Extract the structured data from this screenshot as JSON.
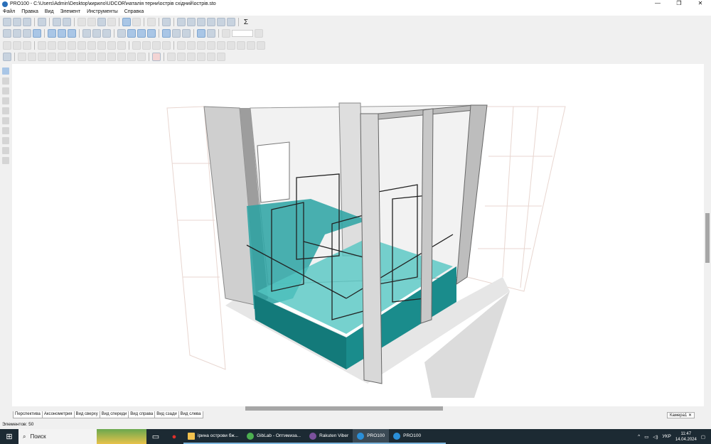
{
  "window": {
    "title": "PRO100 - C:\\Users\\Admin\\Desktop\\кирило\\UDCOR\\наталія терни\\острів східний\\острів.sto",
    "minimize": "—",
    "restore": "❐",
    "close": "✕"
  },
  "menu": [
    "Файл",
    "Правка",
    "Вид",
    "Элемент",
    "Инструменты",
    "Справка"
  ],
  "toolbar": {
    "sigma": "Σ"
  },
  "view_tabs": [
    "Перспектива",
    "Аксонометрия",
    "Вид сверху",
    "Вид спереди",
    "Вид справа",
    "Вид сзади",
    "Вид слева"
  ],
  "camera_tab": "Камера1 ✕",
  "status": "Элементов: 50",
  "taskbar": {
    "search": "Поиск",
    "items": [
      {
        "label": "ірина острови бж...",
        "color": "#f2c14e"
      },
      {
        "label": "GibLab - Оптимиза...",
        "color": "#4caf50"
      },
      {
        "label": "Rakuten Viber",
        "color": "#7b519d"
      },
      {
        "label": "PRO100",
        "color": "#2a8fd8"
      },
      {
        "label": "PRO100",
        "color": "#2a8fd8"
      }
    ],
    "lang": "УКР",
    "time": "11:47",
    "date": "14.04.2024"
  }
}
